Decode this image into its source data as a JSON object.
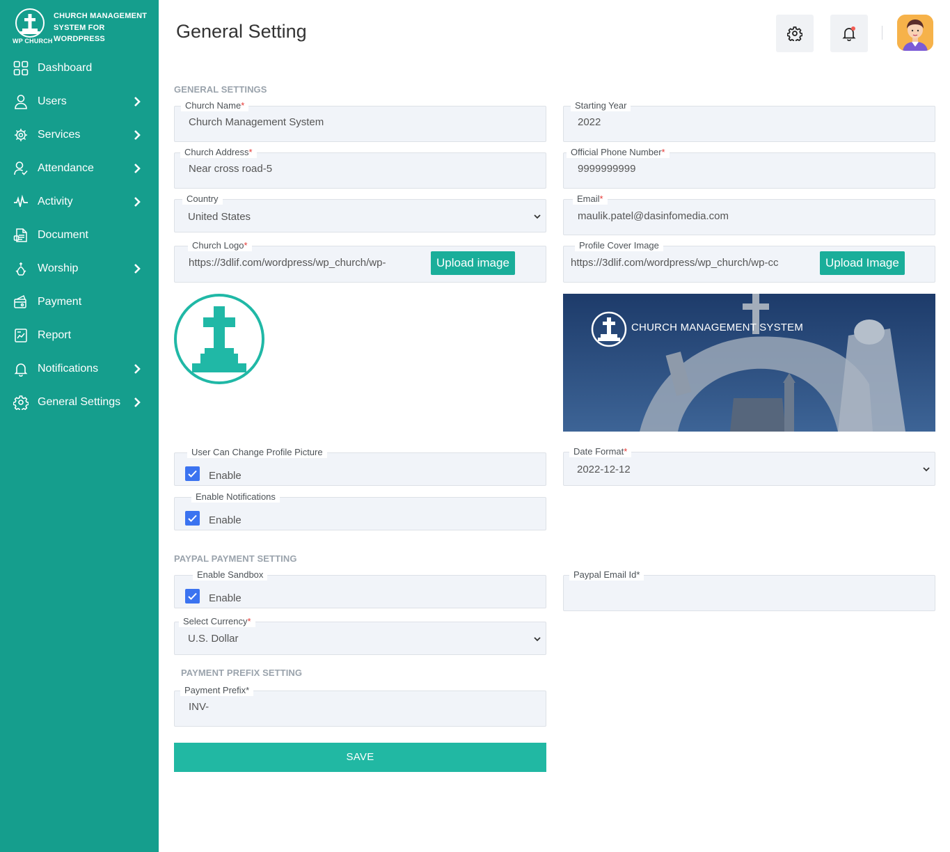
{
  "brand": {
    "title": "CHURCH MANAGEMENT SYSTEM FOR WORDPRESS",
    "sub": "WP CHURCH"
  },
  "sidebar": {
    "items": [
      {
        "label": "Dashboard",
        "icon": "dashboard-grid-icon",
        "has_submenu": false
      },
      {
        "label": "Users",
        "icon": "user-icon",
        "has_submenu": true
      },
      {
        "label": "Services",
        "icon": "services-icon",
        "has_submenu": true
      },
      {
        "label": "Attendance",
        "icon": "attendance-icon",
        "has_submenu": true
      },
      {
        "label": "Activity",
        "icon": "activity-pulse-icon",
        "has_submenu": true
      },
      {
        "label": "Document",
        "icon": "document-icon",
        "has_submenu": false
      },
      {
        "label": "Worship",
        "icon": "worship-icon",
        "has_submenu": true
      },
      {
        "label": "Payment",
        "icon": "payment-icon",
        "has_submenu": false
      },
      {
        "label": "Report",
        "icon": "report-icon",
        "has_submenu": false
      },
      {
        "label": "Notifications",
        "icon": "bell-icon",
        "has_submenu": true
      },
      {
        "label": "General Settings",
        "icon": "gear-icon",
        "has_submenu": true
      }
    ]
  },
  "header": {
    "title": "General Setting"
  },
  "sections": {
    "general": "GENERAL SETTINGS",
    "paypal": "PAYPAL PAYMENT SETTING",
    "prefix": "PAYMENT PREFIX SETTING"
  },
  "fields": {
    "church_name": {
      "label": "Church Name",
      "value": "Church Management System"
    },
    "starting_year": {
      "label": "Starting Year",
      "value": "2022"
    },
    "church_address": {
      "label": "Church Address",
      "value": "Near cross road-5"
    },
    "phone": {
      "label": "Official Phone Number",
      "value": "9999999999"
    },
    "country": {
      "label": "Country",
      "value": "United States"
    },
    "email": {
      "label": "Email",
      "value": "maulik.patel@dasinfomedia.com"
    },
    "church_logo": {
      "label": "Church Logo",
      "value": "https://3dlif.com/wordpress/wp_church/wp-",
      "button": "Upload image"
    },
    "cover_image": {
      "label": "Profile Cover Image",
      "value": "https://3dlif.com/wordpress/wp_church/wp-cc",
      "button": "Upload Image"
    },
    "profile_picture": {
      "label": "User Can Change Profile Picture",
      "check_label": "Enable",
      "checked": true
    },
    "date_format": {
      "label": "Date Format",
      "value": "2022-12-12"
    },
    "enable_notifications": {
      "label": "Enable Notifications",
      "check_label": "Enable",
      "checked": true
    },
    "sandbox": {
      "label": "Enable Sandbox",
      "check_label": "Enable",
      "checked": true
    },
    "paypal_email": {
      "label": "Paypal Email Id",
      "value": ""
    },
    "currency": {
      "label": "Select Currency",
      "value": "U.S. Dollar"
    },
    "prefix": {
      "label": "Payment Prefix*",
      "value": "INV-"
    }
  },
  "cover": {
    "text": "CHURCH MANAGEMENT SYSTEM"
  },
  "save_label": "SAVE",
  "required_mark": "*",
  "colors": {
    "sidebar": "#159e8d",
    "accent": "#1aae9a",
    "checkbox": "#3b73f0",
    "required": "#e53935"
  }
}
